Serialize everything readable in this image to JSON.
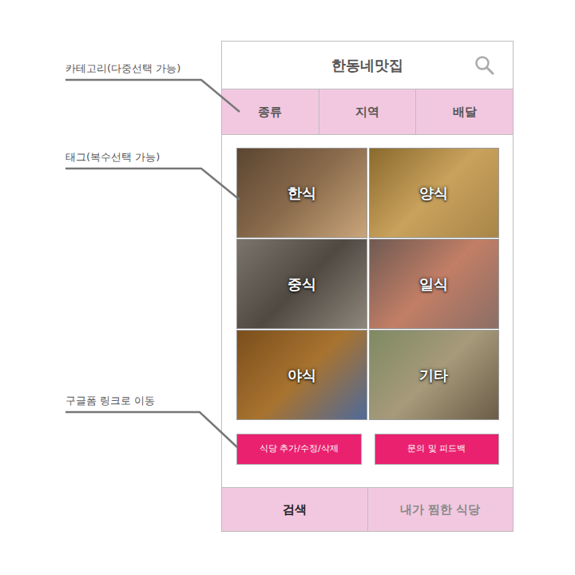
{
  "annotations": [
    {
      "text": "카테고리(다중선택 가능)"
    },
    {
      "text": "태그(복수선택 가능)"
    },
    {
      "text": "구글폼 링크로 이동"
    }
  ],
  "header": {
    "title": "한동네맛집"
  },
  "categories": [
    {
      "label": "종류"
    },
    {
      "label": "지역"
    },
    {
      "label": "배달"
    }
  ],
  "tags": [
    {
      "label": "한식"
    },
    {
      "label": "양식"
    },
    {
      "label": "중식"
    },
    {
      "label": "일식"
    },
    {
      "label": "야식"
    },
    {
      "label": "기타"
    }
  ],
  "buttons": [
    "식당 추가/수정/삭제",
    "문의 및 피드백"
  ],
  "bottom_nav": [
    {
      "label": "검색",
      "selected": true
    },
    {
      "label": "내가 찜한 식당",
      "selected": false
    }
  ]
}
